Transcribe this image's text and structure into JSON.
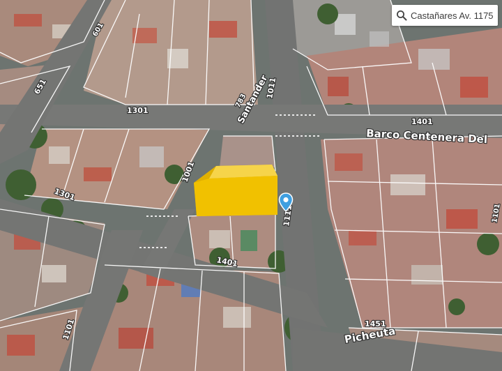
{
  "search": {
    "query": "Castañares Av. 1175",
    "icon": "search-icon"
  },
  "streets": {
    "barco_centenera": "Barco Centenera Del",
    "santander": "Santander",
    "picheuta": "Picheuta"
  },
  "house_numbers": {
    "n_651": "651",
    "n_1301_top": "1301",
    "n_1301_left": "1301",
    "n_1011": "1011",
    "n_1401_right": "1401",
    "n_1001": "1001",
    "n_1111": "1111",
    "n_1401_mid": "1401",
    "n_1451": "1451",
    "n_1101": "1101",
    "n_601": "601",
    "n_783": "783",
    "n_1101_right": "1101"
  },
  "colors": {
    "highlight": "#f2c200",
    "pin": "#3f9fe0",
    "road": "#707070",
    "boundary": "#ffffff"
  }
}
